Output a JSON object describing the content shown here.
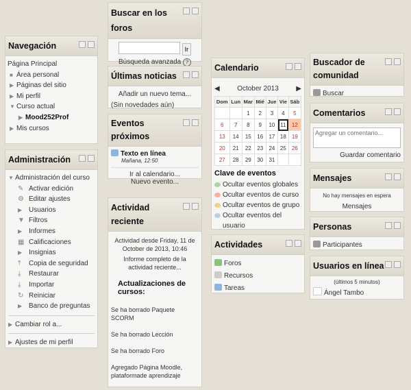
{
  "nav": {
    "title": "Navegación",
    "items": [
      "Página Principal",
      "Área personal",
      "Páginas del sitio",
      "Mi perfil",
      "Curso actual",
      "Mood252Prof",
      "Mis cursos"
    ]
  },
  "admin": {
    "title": "Administración",
    "course_admin": "Administración del curso",
    "items": [
      "Activar edición",
      "Editar ajustes",
      "Usuarios",
      "Filtros",
      "Informes",
      "Calificaciones",
      "Insignias",
      "Copia de seguridad",
      "Restaurar",
      "Importar",
      "Reiniciar",
      "Banco de preguntas"
    ],
    "switch_role": "Cambiar rol a...",
    "profile": "Ajustes de mi perfil"
  },
  "search": {
    "title": "Buscar en los foros",
    "button": "Ir",
    "advanced": "Búsqueda avanzada",
    "help": "?"
  },
  "news": {
    "title": "Últimas noticias",
    "add": "Añadir un nuevo tema...",
    "none": "(Sin novedades aún)"
  },
  "events": {
    "title": "Eventos próximos",
    "event_name": "Texto en línea",
    "event_time": "Mañana, 12:50",
    "goto": "Ir al calendario...",
    "new": "Nuevo evento..."
  },
  "recent": {
    "title": "Actividad reciente",
    "since": "Actividad desde Friday, 11 de October de 2013, 10:46",
    "full": "Informe completo de la actividad reciente...",
    "updates": "Actualizaciones de cursos:",
    "items": [
      "Se ha borrado Paquete SCORM",
      "Se ha borrado Lección",
      "Se ha borrado Foro",
      "Agregado Página Moodle, plataformade aprendizaje"
    ]
  },
  "calendar": {
    "title": "Calendario",
    "month": "October 2013",
    "prev": "◀",
    "next": "▶",
    "days": [
      "Dom",
      "Lun",
      "Mar",
      "Mié",
      "Jue",
      "Vie",
      "Sáb"
    ],
    "weeks": [
      [
        "",
        "",
        "1",
        "2",
        "3",
        "4",
        "5"
      ],
      [
        "6",
        "7",
        "8",
        "9",
        "10",
        "11",
        "12"
      ],
      [
        "13",
        "14",
        "15",
        "16",
        "17",
        "18",
        "19"
      ],
      [
        "20",
        "21",
        "22",
        "23",
        "24",
        "25",
        "26"
      ],
      [
        "27",
        "28",
        "29",
        "30",
        "31",
        "",
        ""
      ]
    ],
    "today": "11",
    "event_day": "12",
    "key_title": "Clave de eventos",
    "key": [
      "Ocultar eventos globales",
      "Ocultar eventos de curso",
      "Ocultar eventos de grupo",
      "Ocultar eventos del usuario"
    ],
    "key_colors": [
      "#a7d8a0",
      "#f6b0a0",
      "#f2d08a",
      "#b7d0e6"
    ]
  },
  "activities": {
    "title": "Actividades",
    "items": [
      "Foros",
      "Recursos",
      "Tareas"
    ]
  },
  "community": {
    "title": "Buscador de comunidad",
    "link": "Buscar"
  },
  "comments": {
    "title": "Comentarios",
    "placeholder": "Agregar un comentario...",
    "save": "Guardar comentario"
  },
  "messages": {
    "title": "Mensajes",
    "none": "No hay mensajes en espera",
    "link": "Mensajes"
  },
  "people": {
    "title": "Personas",
    "link": "Participantes"
  },
  "online": {
    "title": "Usuarios en línea",
    "period": "(últimos 5 minutos)",
    "user": "Ángel Tambo"
  }
}
